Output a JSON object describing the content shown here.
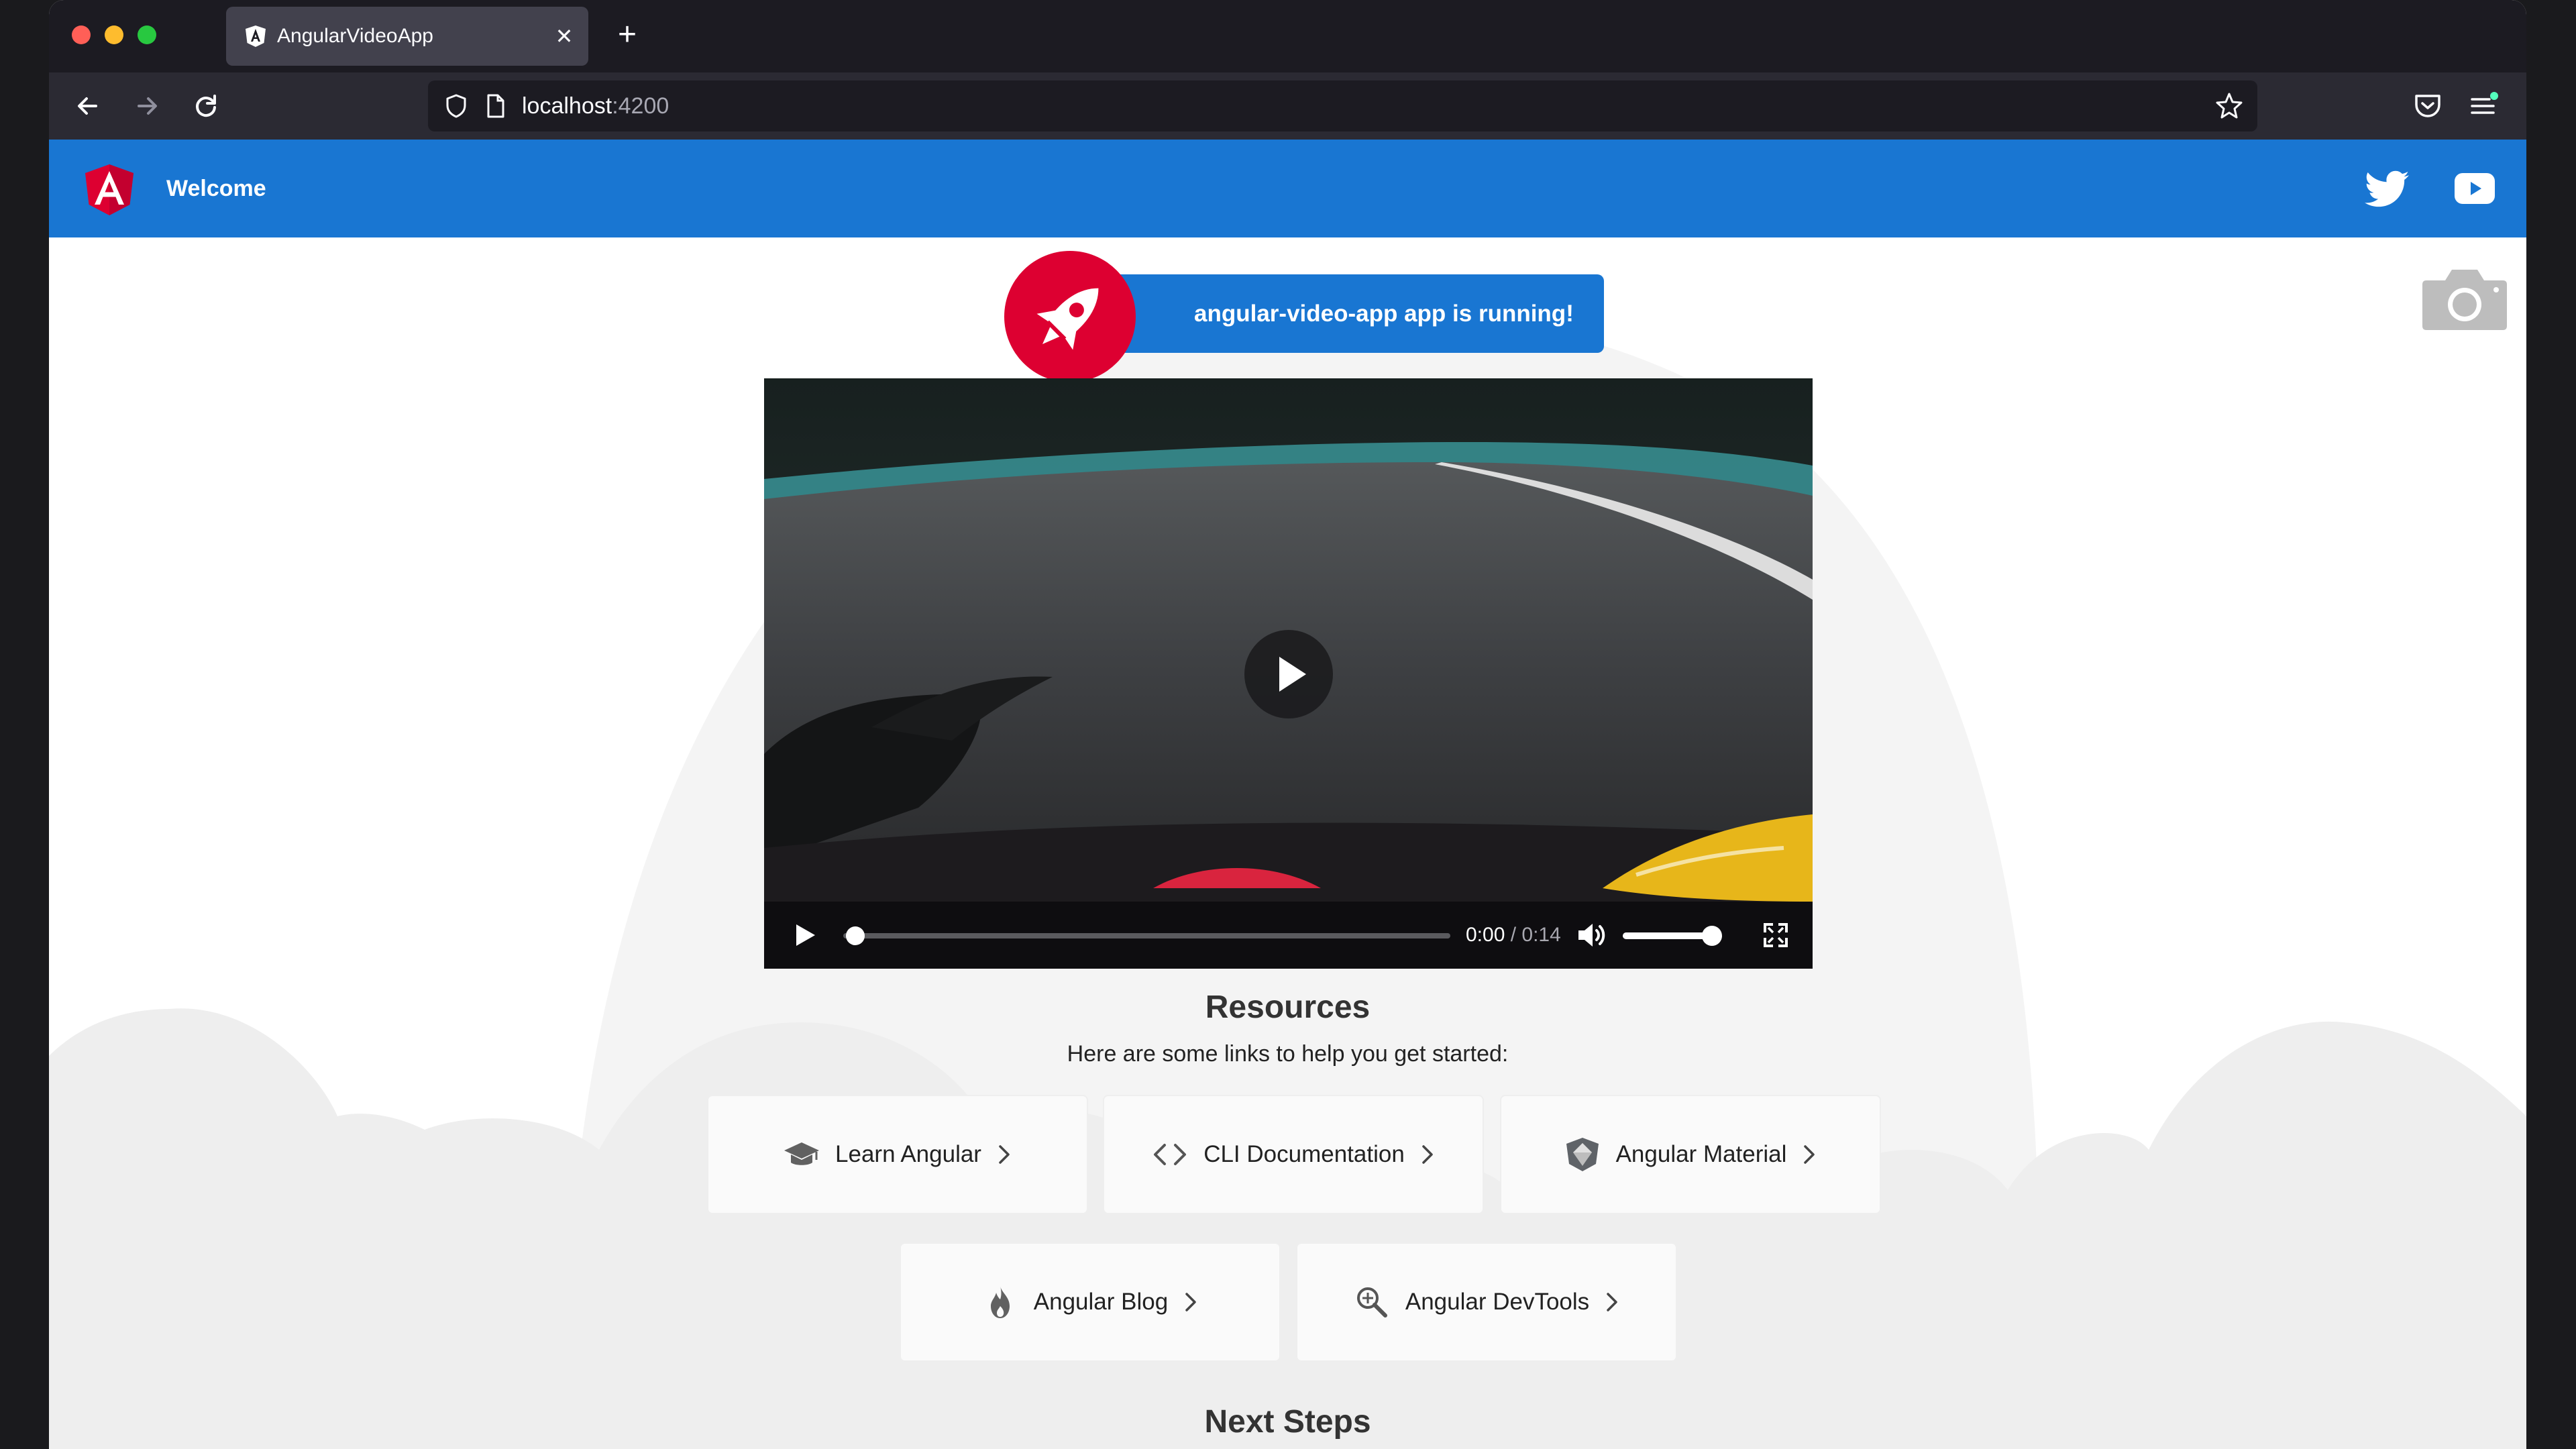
{
  "browser": {
    "tab_title": "AngularVideoApp",
    "tab_close": "✕",
    "new_tab": "+",
    "url_host": "localhost",
    "url_port": ":4200"
  },
  "toolbar": {
    "title": "Welcome",
    "logo_letter": "A"
  },
  "badge": {
    "text": "angular-video-app app is running!"
  },
  "video": {
    "current_time": "0:00",
    "separator": " / ",
    "duration": "0:14",
    "progress_fraction": 0.02,
    "volume_fraction": 0.9
  },
  "resources": {
    "title": "Resources",
    "subtitle": "Here are some links to help you get started:",
    "cards": [
      {
        "label": "Learn Angular",
        "icon": "graduation-cap-icon"
      },
      {
        "label": "CLI Documentation",
        "icon": "code-icon"
      },
      {
        "label": "Angular Material",
        "icon": "material-shield-icon"
      },
      {
        "label": "Angular Blog",
        "icon": "flame-icon"
      },
      {
        "label": "Angular DevTools",
        "icon": "magnifier-icon"
      }
    ]
  },
  "next_steps": {
    "title": "Next Steps"
  },
  "colors": {
    "angular_blue": "#1976d2",
    "angular_red": "#dd0031",
    "browser_dark": "#1c1b22",
    "toolbar_dark": "#2b2a33"
  }
}
